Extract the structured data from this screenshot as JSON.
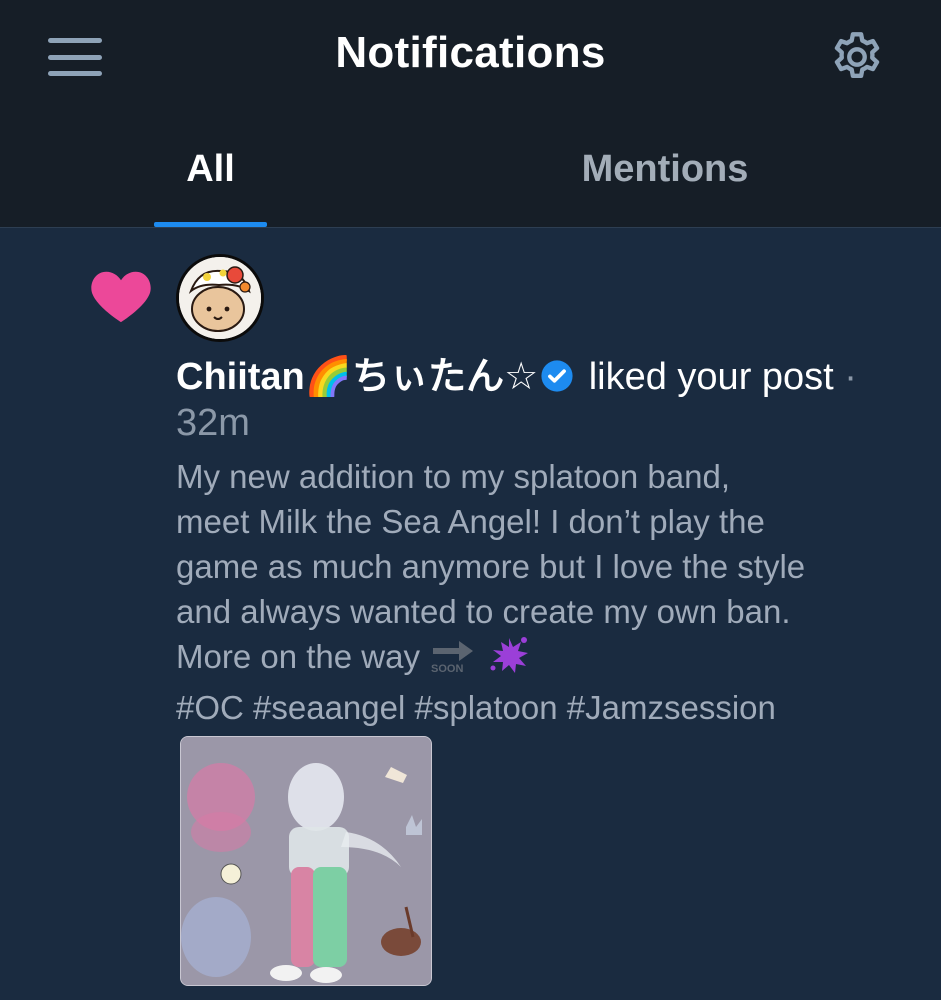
{
  "header": {
    "title": "Notifications",
    "menu_icon": "hamburger-menu-icon",
    "settings_icon": "gear-icon"
  },
  "tabs": [
    {
      "label": "All",
      "active": true
    },
    {
      "label": "Mentions",
      "active": false
    }
  ],
  "notification": {
    "type_icon": "heart-icon",
    "user_name": "Chiitan🌈ちぃたん☆",
    "verified": true,
    "action": " liked your post",
    "time": " · 32m",
    "post_text_lines": [
      "My new addition to my splatoon band,",
      "meet Milk the Sea Angel! I don’t play the",
      "game as much anymore but I love the style",
      "and always wanted to create my own ban.",
      "More on the way"
    ],
    "post_emojis": [
      "soon-arrow-emoji",
      "purple-splat-emoji"
    ],
    "hashtags": "#OC #seaangel #splatoon #Jamzsession",
    "attachment": "artwork-thumbnail"
  },
  "colors": {
    "background": "#1a2b40",
    "header_bg": "#161e27",
    "accent": "#1d8bf0",
    "heart": "#ec4899",
    "muted_text": "#a0abba"
  }
}
